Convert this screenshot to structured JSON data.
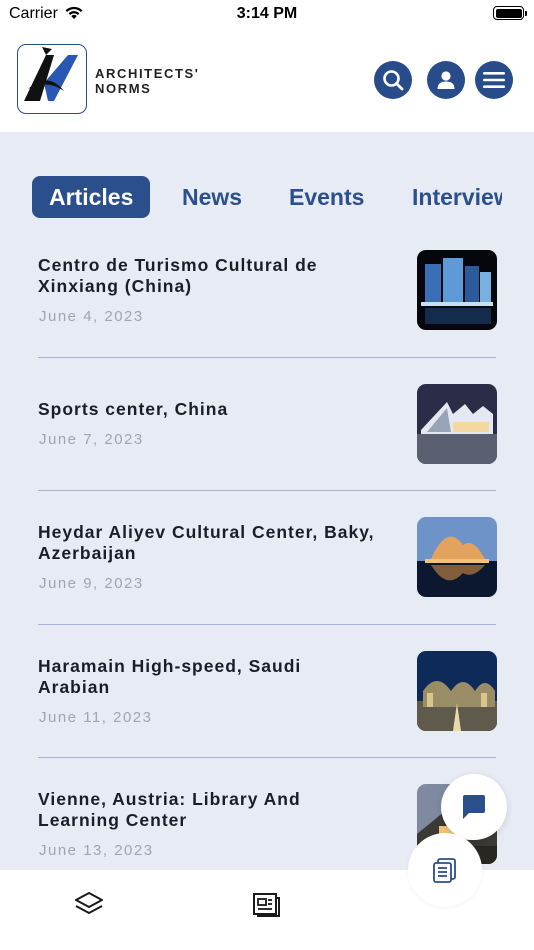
{
  "status_bar": {
    "carrier": "Carrier",
    "time": "3:14 PM"
  },
  "header": {
    "brand_line1": "ARCHITECTS'",
    "brand_line2": "NORMS",
    "icons": [
      "search-icon",
      "user-icon",
      "menu-icon"
    ],
    "accent_color": "#284b8a"
  },
  "tabs": [
    {
      "label": "Articles",
      "active": true
    },
    {
      "label": "News",
      "active": false
    },
    {
      "label": "Events",
      "active": false
    },
    {
      "label": "Interviews",
      "active": false
    }
  ],
  "articles": [
    {
      "title": "Centro de Turismo Cultural de Xinxiang (China)",
      "date": "June 4, 2023"
    },
    {
      "title": "Sports center, China",
      "date": "June 7, 2023"
    },
    {
      "title": "Heydar Aliyev Cultural Center, Baky, Azerbaijan",
      "date": "June 9, 2023"
    },
    {
      "title": "Haramain High-speed, Saudi Arabian",
      "date": "June 11, 2023"
    },
    {
      "title": "Vienne, Austria: Library And Learning Center",
      "date": "June 13, 2023"
    }
  ],
  "bottom_nav": {
    "icons": [
      "layers-icon",
      "news-icon",
      "document-list-icon"
    ]
  },
  "floating": {
    "icon": "chat-icon"
  },
  "colors": {
    "background": "#e7ebf3",
    "divider": "#a6b2d6",
    "date": "#a2a5ad"
  }
}
